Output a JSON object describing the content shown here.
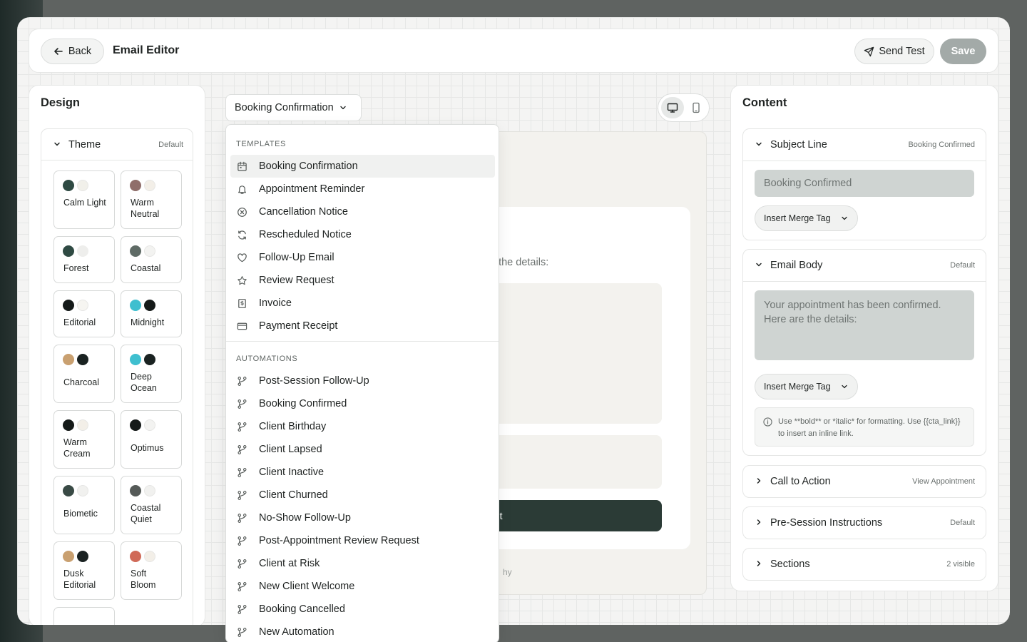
{
  "header": {
    "back_label": "Back",
    "title": "Email Editor",
    "send_test_label": "Send Test",
    "save_label": "Save"
  },
  "design": {
    "title": "Design",
    "theme": {
      "label": "Theme",
      "value": "Default",
      "options": [
        {
          "name": "Calm Light",
          "colors": [
            "#2f4a43",
            "#f1f0ea"
          ]
        },
        {
          "name": "Warm Neutral",
          "colors": [
            "#8f6e6a",
            "#f3efe8"
          ]
        },
        {
          "name": "Forest",
          "colors": [
            "#2f4a43",
            "#eeeeec"
          ]
        },
        {
          "name": "Coastal",
          "colors": [
            "#5f6b66",
            "#f3f3f1"
          ]
        },
        {
          "name": "Editorial",
          "colors": [
            "#151a19",
            "#f6f5f1"
          ]
        },
        {
          "name": "Midnight",
          "colors": [
            "#3fbfcf",
            "#151a19"
          ]
        },
        {
          "name": "Charcoal",
          "colors": [
            "#c9a070",
            "#1a2221"
          ]
        },
        {
          "name": "Deep Ocean",
          "colors": [
            "#3fbfcf",
            "#1a2221"
          ]
        },
        {
          "name": "Warm Cream",
          "colors": [
            "#151a19",
            "#f3efe8"
          ]
        },
        {
          "name": "Optimus",
          "colors": [
            "#151a19",
            "#f3f3f1"
          ]
        },
        {
          "name": "Biometic",
          "colors": [
            "#394a45",
            "#f1f1ef"
          ]
        },
        {
          "name": "Coastal Quiet",
          "colors": [
            "#555a58",
            "#f1f1ef"
          ]
        },
        {
          "name": "Dusk Editorial",
          "colors": [
            "#c9a070",
            "#1a2221"
          ]
        },
        {
          "name": "Soft Bloom",
          "colors": [
            "#d06a58",
            "#f3efe8"
          ]
        }
      ]
    }
  },
  "template_select": {
    "selected": "Booking Confirmation",
    "groups": [
      {
        "label": "TEMPLATES",
        "items": [
          {
            "label": "Booking Confirmation",
            "icon": "calendar-icon"
          },
          {
            "label": "Appointment Reminder",
            "icon": "bell-icon"
          },
          {
            "label": "Cancellation Notice",
            "icon": "x-circle-icon"
          },
          {
            "label": "Rescheduled Notice",
            "icon": "refresh-icon"
          },
          {
            "label": "Follow-Up Email",
            "icon": "heart-icon"
          },
          {
            "label": "Review Request",
            "icon": "star-icon"
          },
          {
            "label": "Invoice",
            "icon": "invoice-icon"
          },
          {
            "label": "Payment Receipt",
            "icon": "card-icon"
          }
        ]
      },
      {
        "label": "AUTOMATIONS",
        "items": [
          {
            "label": "Post-Session Follow-Up",
            "icon": "workflow-icon"
          },
          {
            "label": "Booking Confirmed",
            "icon": "workflow-icon"
          },
          {
            "label": "Client Birthday",
            "icon": "workflow-icon"
          },
          {
            "label": "Client Lapsed",
            "icon": "workflow-icon"
          },
          {
            "label": "Client Inactive",
            "icon": "workflow-icon"
          },
          {
            "label": "Client Churned",
            "icon": "workflow-icon"
          },
          {
            "label": "No-Show Follow-Up",
            "icon": "workflow-icon"
          },
          {
            "label": "Post-Appointment Review Request",
            "icon": "workflow-icon"
          },
          {
            "label": "Client at Risk",
            "icon": "workflow-icon"
          },
          {
            "label": "New Client Welcome",
            "icon": "workflow-icon"
          },
          {
            "label": "Booking Cancelled",
            "icon": "workflow-icon"
          },
          {
            "label": "New Automation",
            "icon": "workflow-icon"
          }
        ]
      }
    ]
  },
  "preview": {
    "body_text_fragment": "e the details:",
    "button_fragment": "ent",
    "footer_fragment": "hy"
  },
  "content": {
    "title": "Content",
    "subject": {
      "label": "Subject Line",
      "meta": "Booking Confirmed",
      "value": "Booking Confirmed",
      "merge_label": "Insert Merge Tag"
    },
    "body": {
      "label": "Email Body",
      "meta": "Default",
      "value": "Your appointment has been confirmed. Here are the details:",
      "merge_label": "Insert Merge Tag",
      "hint": "Use **bold** or *italic* for formatting. Use {{cta_link}} to insert an inline link."
    },
    "cta": {
      "label": "Call to Action",
      "meta": "View Appointment"
    },
    "pre_session": {
      "label": "Pre-Session Instructions",
      "meta": "Default"
    },
    "sections": {
      "label": "Sections",
      "meta": "2 visible"
    }
  },
  "colors": {
    "accent_dark": "#2b3b36",
    "save_disabled": "#a3aaa8"
  }
}
